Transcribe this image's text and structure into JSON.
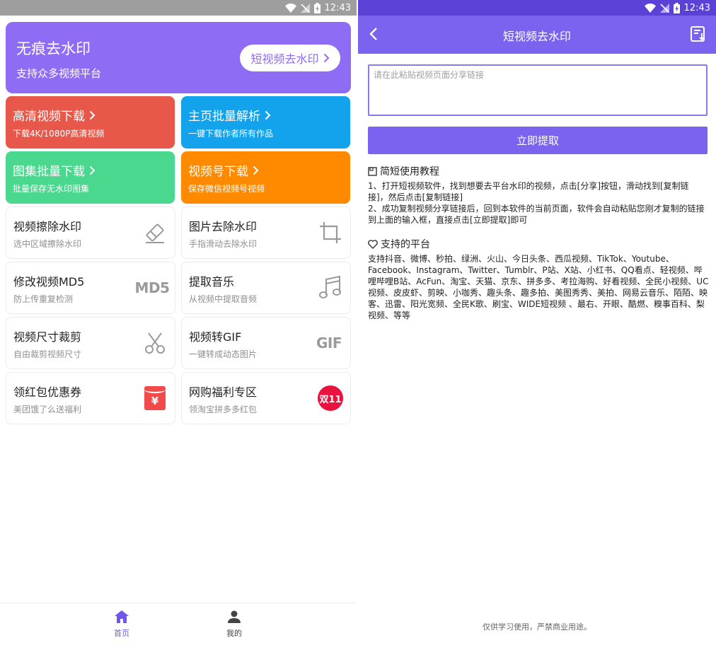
{
  "status_bar": {
    "time": "12:43"
  },
  "home": {
    "hero": {
      "title": "无痕去水印",
      "subtitle": "支持众多视频平台",
      "button": "短视频去水印"
    },
    "feature_cards": [
      {
        "title": "高清视频下载",
        "subtitle": "下载4K/1080P高清视频",
        "color": "#e7584a"
      },
      {
        "title": "主页批量解析",
        "subtitle": "一键下载作者所有作品",
        "color": "#12a3ec"
      },
      {
        "title": "图集批量下载",
        "subtitle": "批量保存无水印图集",
        "color": "#4ad88e"
      },
      {
        "title": "视频号下载",
        "subtitle": "保存微信视频号视频",
        "color": "#ff8a00"
      }
    ],
    "tools": [
      {
        "title": "视频擦除水印",
        "subtitle": "选中区域擦除水印",
        "icon": "eraser-icon"
      },
      {
        "title": "图片去除水印",
        "subtitle": "手指滑动去除水印",
        "icon": "crop-icon"
      },
      {
        "title": "修改视频MD5",
        "subtitle": "防上传重复检测",
        "icon": "md5-icon",
        "icon_text": "MD5"
      },
      {
        "title": "提取音乐",
        "subtitle": "从视频中提取音频",
        "icon": "music-note-icon"
      },
      {
        "title": "视频尺寸裁剪",
        "subtitle": "自由裁剪视频尺寸",
        "icon": "scissors-icon"
      },
      {
        "title": "视频转GIF",
        "subtitle": "一键转成动态图片",
        "icon": "gif-icon",
        "icon_text": "GIF"
      },
      {
        "title": "领红包优惠券",
        "subtitle": "美团饿了么送福利",
        "icon": "red-envelope-icon",
        "icon_text": "¥"
      },
      {
        "title": "网购福利专区",
        "subtitle": "领淘宝拼多多红包",
        "icon": "double-eleven-icon",
        "icon_text": "双11"
      }
    ],
    "bottom_nav": [
      {
        "label": "首页",
        "icon": "home-icon",
        "active": true
      },
      {
        "label": "我的",
        "icon": "person-icon",
        "active": false
      }
    ]
  },
  "extract_page": {
    "title": "短视频去水印",
    "input_placeholder": "请在此粘贴视频页面分享链接",
    "extract_button": "立即提取",
    "tutorial": {
      "title": "简短使用教程",
      "step1": "1、打开短视频软件，找到想要去平台水印的视频，点击[分享]按钮，滑动找到[复制链接]，然后点击[复制链接]",
      "step2": "2、成功复制视频分享链接后，回到本软件的当前页面，软件会自动粘贴您刚才复制的链接到上面的输入框，直接点击[立即提取]即可"
    },
    "platforms": {
      "title": "支持的平台",
      "text": "支持抖音、微博、秒拍、绿洲、火山、今日头条、西瓜视频、TikTok、Youtube、Facebook、Instagram、Twitter、Tumblr、P站、X站、小红书、QQ看点、轻视频、哔哩哔哩B站、AcFun、淘宝、天猫、京东、拼多多、考拉海购、好看视频、全民小视频、UC视频、皮皮虾、剪映、小咖秀、趣头条、趣多拍、美图秀秀、美拍、网易云音乐、陌陌、映客、迅雷、阳光宽频、全民K歌、刷宝、WIDE短视频 、最右、开眼、酷燃、糗事百科、梨视频、等等"
    },
    "footer": "仅供学习使用，严禁商业用途。"
  }
}
